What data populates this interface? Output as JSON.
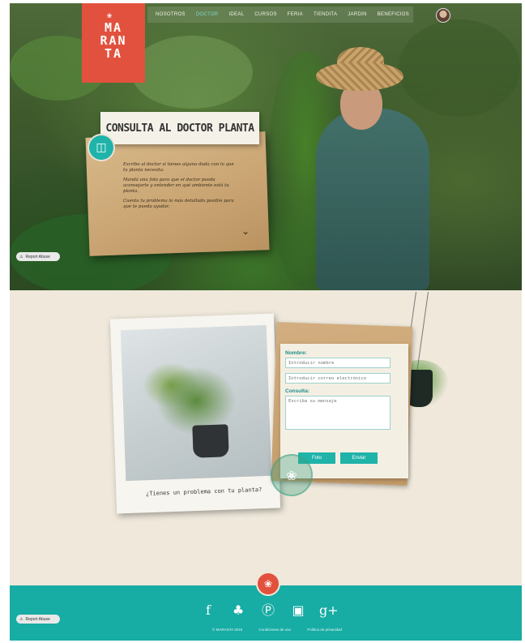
{
  "brand": {
    "logo_lines": [
      "MA",
      "RAN",
      "TA"
    ],
    "logo_mark": "❀"
  },
  "nav": {
    "items": [
      {
        "label": "NOSOTROS"
      },
      {
        "label": "DOCTOR",
        "active": true
      },
      {
        "label": "IDEAL"
      },
      {
        "label": "CURSOS"
      },
      {
        "label": "FERIA"
      },
      {
        "label": "TIENDITA"
      },
      {
        "label": "JARDIN"
      },
      {
        "label": "BENEFICIOS"
      }
    ]
  },
  "hero": {
    "card_title": "CONSULTA AL DOCTOR PLANTA",
    "card_paragraphs": [
      "Escribe al doctor si tienes alguna duda con lo que tu planta necesita.",
      "Mandá una foto para que el doctor pueda aconsejarte y entender en qué ambiente está tu planta.",
      "Cuenta tu problema lo más detallado posible para que te pueda ayudar."
    ],
    "chevron": "⌄"
  },
  "report_abuse": {
    "label": "Report Abuse",
    "icon": "warning-icon"
  },
  "consult": {
    "polaroid_caption": "¿Tienes un problema con tu planta?",
    "form": {
      "name_label": "Nombre:",
      "name_placeholder": "Introducir nombre",
      "email_placeholder": "Introducir correo electrónico",
      "consulta_label": "Consulta:",
      "consulta_placeholder": "Escriba su mensaje",
      "foto_button": "Foto",
      "enviar_button": "Enviar"
    }
  },
  "footer": {
    "logo_mark": "❀",
    "social": [
      "facebook-icon",
      "twitter-icon",
      "pinterest-icon",
      "instagram-icon",
      "google-plus-icon"
    ],
    "social_glyphs": [
      "f",
      "♣",
      "Ⓟ",
      "▣",
      "g+"
    ],
    "links": [
      "© MARANTA 2015",
      "Condiciones de uso",
      "Política de privacidad"
    ]
  },
  "colors": {
    "accent": "#1fb3a9",
    "brand": "#e2513d",
    "footer": "#17aca4",
    "background": "#efe8db"
  }
}
